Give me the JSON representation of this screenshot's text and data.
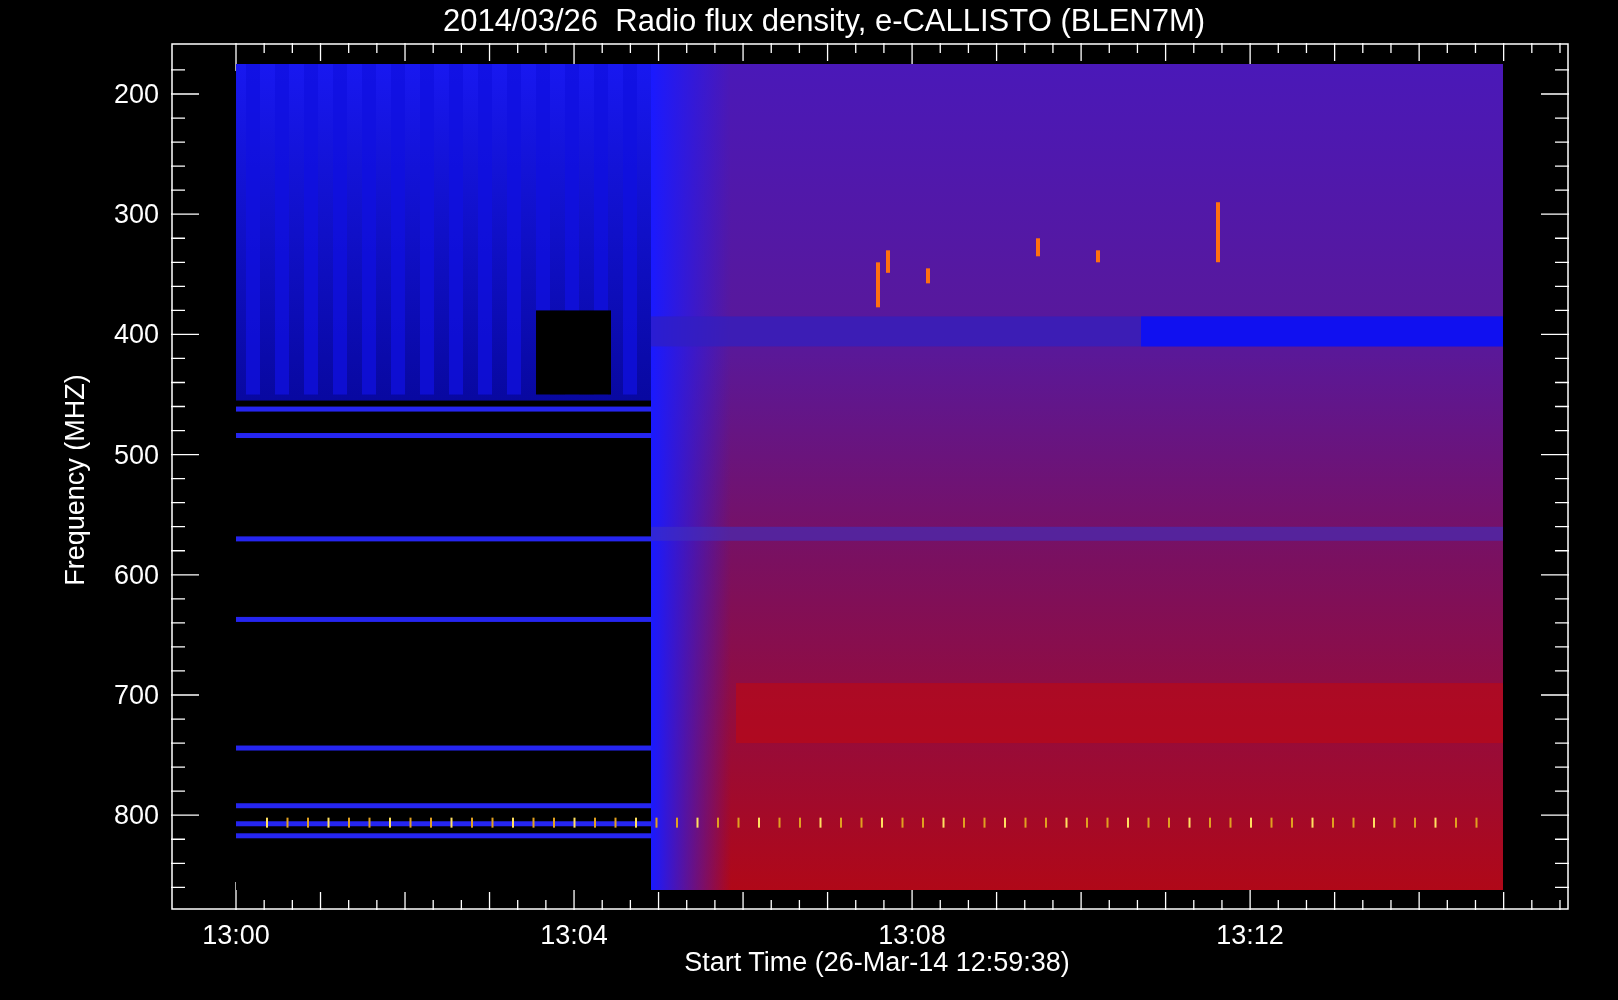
{
  "title": "2014/03/26  Radio flux density, e-CALLISTO (BLEN7M)",
  "ylabel": "Frequency (MHZ)",
  "xlabel": "Start Time (26-Mar-14 12:59:38)",
  "yticks": [
    "200",
    "300",
    "400",
    "500",
    "600",
    "700",
    "800"
  ],
  "xticks": [
    "13:00",
    "13:04",
    "13:08",
    "13:12"
  ]
}
